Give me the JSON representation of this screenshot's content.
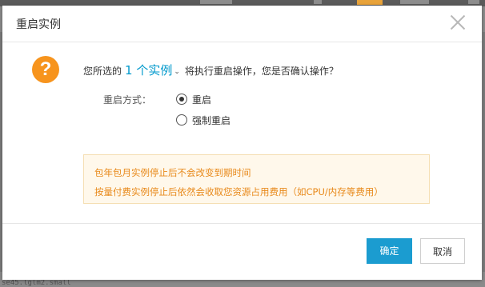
{
  "dialog": {
    "title": "重启实例",
    "close_icon": "close-icon",
    "warning_icon_glyph": "?",
    "question": {
      "prefix": "您所选的",
      "link": "1 个实例",
      "caret": "⌄",
      "suffix": "将执行重启操作，您是否确认操作？"
    },
    "restart_mode": {
      "label": "重启方式：",
      "options": [
        {
          "label": "重启",
          "selected": true
        },
        {
          "label": "强制重启",
          "selected": false
        }
      ]
    },
    "notice": {
      "lines": [
        "包年包月实例停止后不会改变到期时间",
        "按量付费实例停止后依然会收取您资源占用费用（如CPU/内存等费用）"
      ]
    },
    "buttons": {
      "ok": "确定",
      "cancel": "取消"
    }
  },
  "background": {
    "bottom_text": "se45.lglm2.small"
  },
  "colors": {
    "accent": "#1b9cd0",
    "link": "#0099cc",
    "warning": "#f7941d",
    "notice_text": "#e8891a",
    "notice_bg": "#fff8eb"
  }
}
